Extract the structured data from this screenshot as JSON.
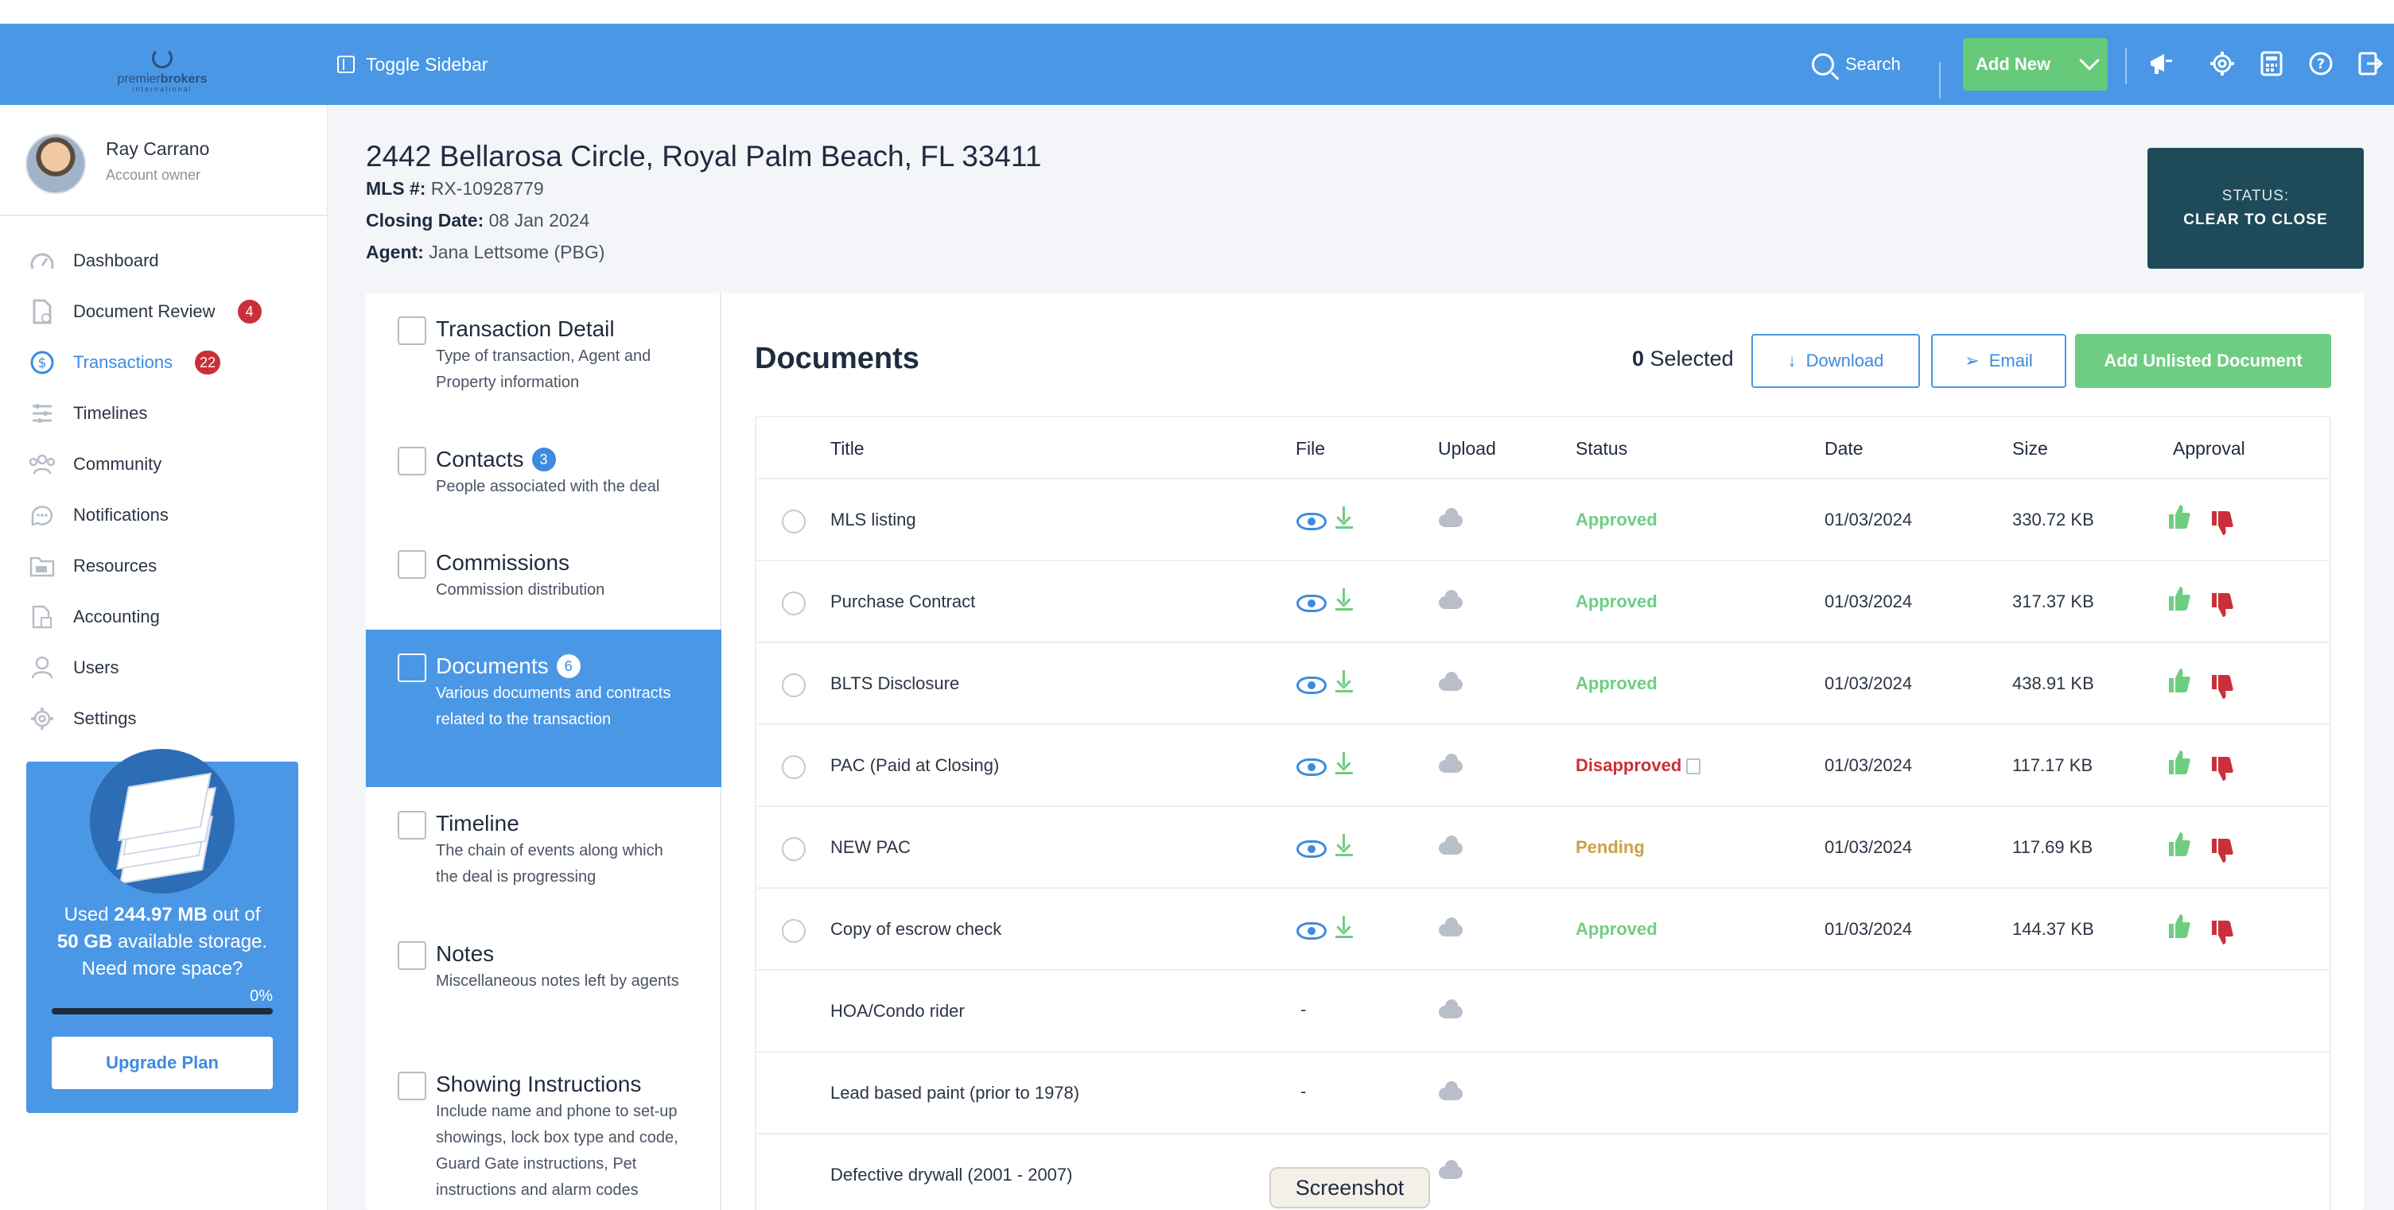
{
  "header": {
    "logo_text_1": "premier",
    "logo_text_2": "brokers",
    "logo_sub": "international",
    "toggle_sidebar_label": "Toggle Sidebar",
    "search_label": "Search",
    "add_new_label": "Add New"
  },
  "profile": {
    "name": "Ray Carrano",
    "role": "Account owner"
  },
  "nav": [
    {
      "label": "Dashboard",
      "icon": "gauge-icon"
    },
    {
      "label": "Document Review",
      "badge": "4",
      "icon": "doc-check-icon"
    },
    {
      "label": "Transactions",
      "badge": "22",
      "icon": "dollar-circle-icon",
      "active": true
    },
    {
      "label": "Timelines",
      "icon": "timeline-icon"
    },
    {
      "label": "Community",
      "icon": "people-icon"
    },
    {
      "label": "Notifications",
      "icon": "chat-icon"
    },
    {
      "label": "Resources",
      "icon": "folder-icon"
    },
    {
      "label": "Accounting",
      "icon": "calculator-icon"
    },
    {
      "label": "Users",
      "icon": "user-icon"
    },
    {
      "label": "Settings",
      "icon": "gear-icon"
    }
  ],
  "storage": {
    "used_prefix": "Used",
    "used": "244.97 MB",
    "out_of": "out of",
    "total": "50 GB",
    "available": "available storage.",
    "need_more": "Need more space?",
    "percent_label": "0%",
    "percent_value": 0,
    "upgrade_label": "Upgrade Plan"
  },
  "property": {
    "address": "2442 Bellarosa Circle, Royal Palm Beach, FL 33411",
    "mls_label": "MLS #:",
    "mls_value": "RX-10928779",
    "closing_label": "Closing Date:",
    "closing_value": "08 Jan 2024",
    "agent_label": "Agent:",
    "agent_value": "Jana Lettsome (PBG)",
    "status_label": "STATUS:",
    "status_value": "CLEAR TO CLOSE"
  },
  "tabs": [
    {
      "title": "Transaction Detail",
      "desc": "Type of transaction, Agent and Property information"
    },
    {
      "title": "Contacts",
      "badge": "3",
      "desc": "People associated with the deal"
    },
    {
      "title": "Commissions",
      "desc": "Commission distribution"
    },
    {
      "title": "Documents",
      "badge": "6",
      "desc": "Various documents and contracts related to the transaction",
      "active": true
    },
    {
      "title": "Timeline",
      "desc": "The chain of events along which the deal is progressing"
    },
    {
      "title": "Notes",
      "desc": "Miscellaneous notes left by agents"
    },
    {
      "title": "Showing Instructions",
      "desc": "Include name and phone to set-up showings, lock box type and code, Guard Gate instructions, Pet instructions and alarm codes"
    }
  ],
  "documents": {
    "title": "Documents",
    "selected_count": "0",
    "selected_label": "Selected",
    "download_label": "Download",
    "email_label": "Email",
    "add_unlisted_label": "Add Unlisted Document",
    "columns": [
      "Title",
      "File",
      "Upload",
      "Status",
      "Date",
      "Size",
      "Approval"
    ],
    "rows": [
      {
        "title": "MLS listing",
        "status": "Approved",
        "date": "01/03/2024",
        "size": "330.72 KB"
      },
      {
        "title": "Purchase Contract",
        "status": "Approved",
        "date": "01/03/2024",
        "size": "317.37 KB"
      },
      {
        "title": "BLTS Disclosure",
        "status": "Approved",
        "date": "01/03/2024",
        "size": "438.91 KB"
      },
      {
        "title": "PAC (Paid at Closing)",
        "status": "Disapproved",
        "date": "01/03/2024",
        "size": "117.17 KB"
      },
      {
        "title": "NEW PAC",
        "status": "Pending",
        "date": "01/03/2024",
        "size": "117.69 KB"
      },
      {
        "title": "Copy of escrow check",
        "status": "Approved",
        "date": "01/03/2024",
        "size": "144.37 KB"
      },
      {
        "title": "HOA/Condo rider",
        "file": "-"
      },
      {
        "title": "Lead based paint (prior to 1978)",
        "file": "-"
      },
      {
        "title": "Defective drywall (2001 - 2007)"
      }
    ]
  },
  "tooltip": "Screenshot",
  "colors": {
    "header_blue": "#4a97e6",
    "green": "#6fcd82",
    "red": "#c9303a",
    "status_box": "#1e4a59"
  }
}
